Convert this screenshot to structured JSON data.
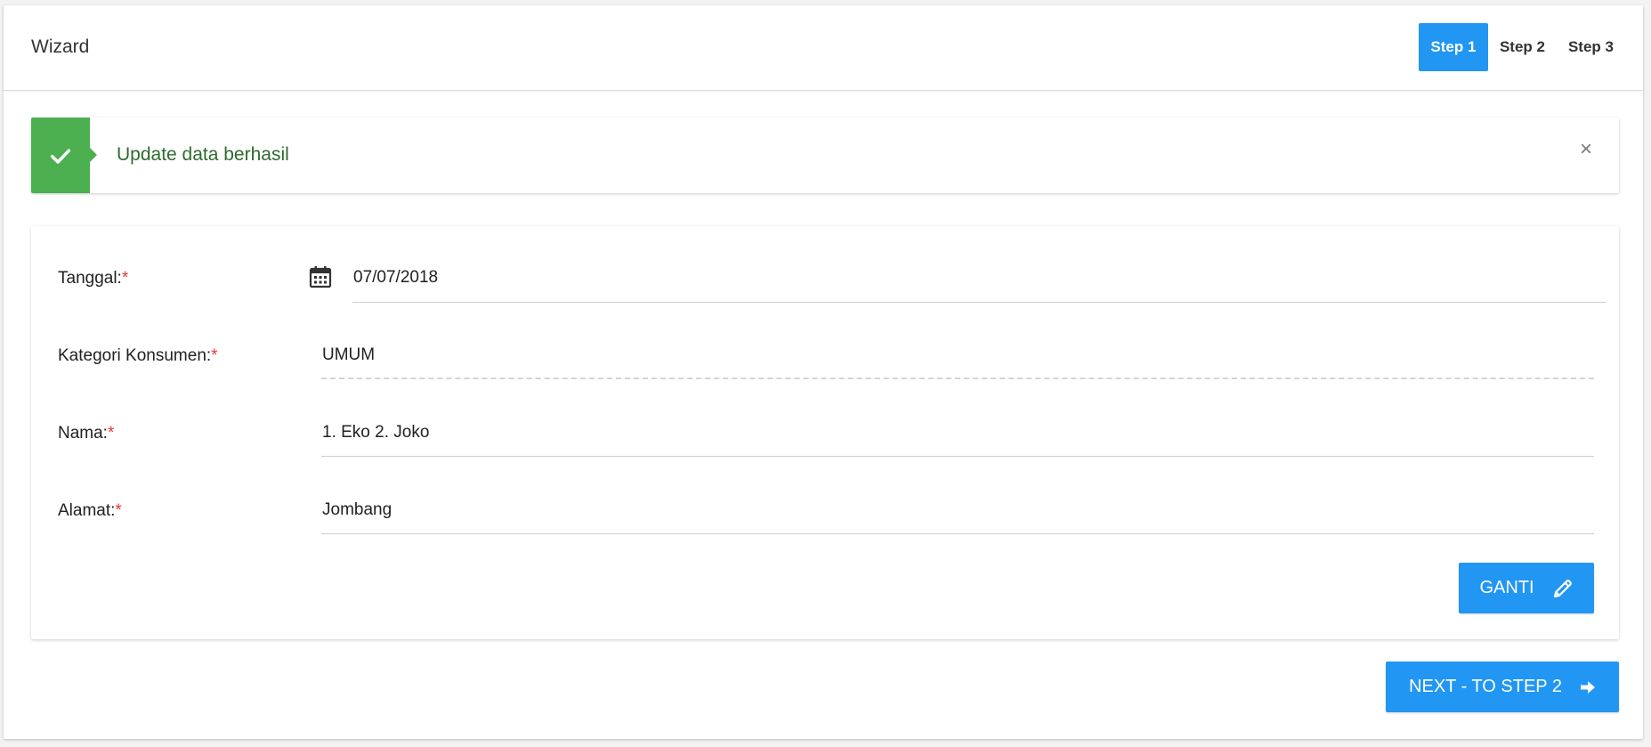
{
  "header": {
    "title": "Wizard",
    "steps": [
      {
        "label": "Step 1",
        "active": true
      },
      {
        "label": "Step 2",
        "active": false
      },
      {
        "label": "Step 3",
        "active": false
      }
    ]
  },
  "alert": {
    "message": "Update data berhasil",
    "close_glyph": "×",
    "icon": "check-icon",
    "color": "#4caf50"
  },
  "form": {
    "tanggal": {
      "label": "Tanggal:",
      "required": "*",
      "value": "07/07/2018",
      "icon": "calendar-icon"
    },
    "kategori": {
      "label": "Kategori Konsumen:",
      "required": "*",
      "value": "UMUM"
    },
    "nama": {
      "label": "Nama:",
      "required": "*",
      "value": "1. Eko 2. Joko"
    },
    "alamat": {
      "label": "Alamat:",
      "required": "*",
      "value": "Jombang"
    },
    "edit_button": {
      "label": "GANTI",
      "icon": "pencil-icon"
    }
  },
  "footer": {
    "next_button": {
      "label": "NEXT - TO STEP 2",
      "icon": "arrow-right-icon"
    }
  },
  "colors": {
    "primary": "#2196f3",
    "success": "#4caf50",
    "required": "#e53935"
  }
}
